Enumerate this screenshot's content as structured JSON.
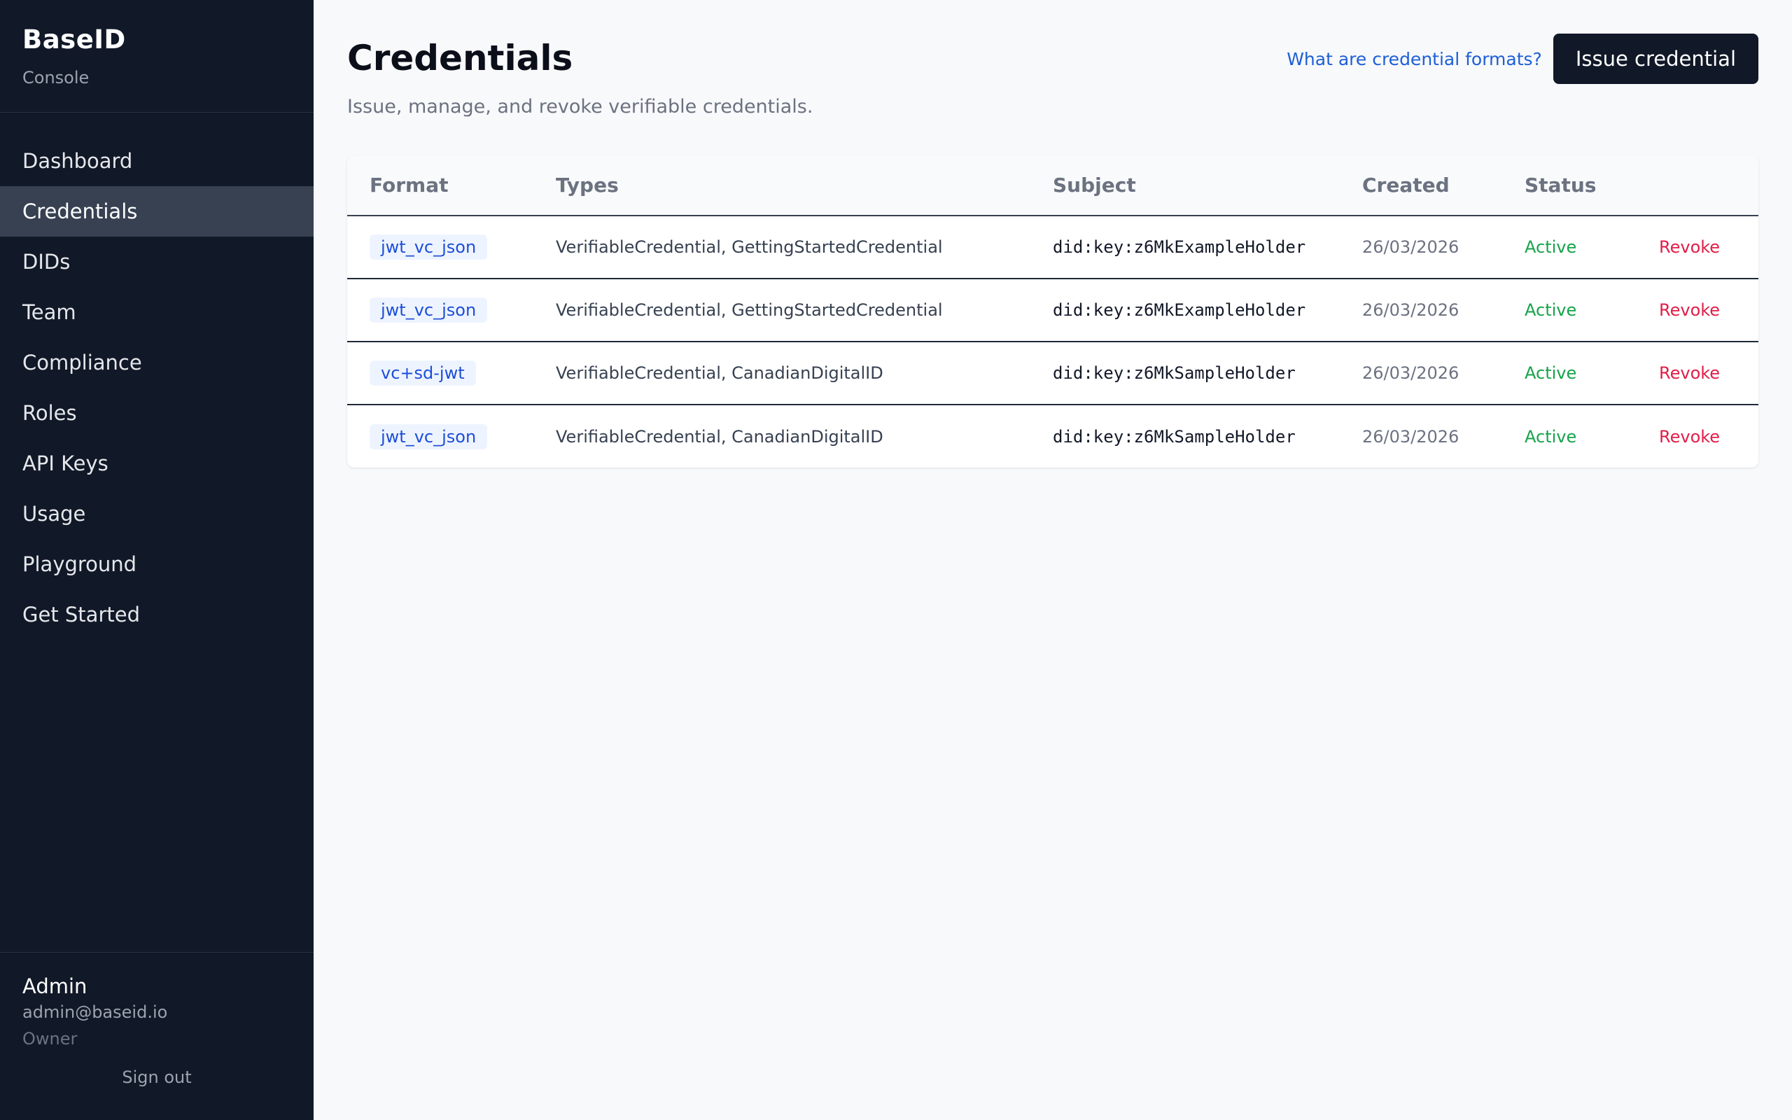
{
  "sidebar": {
    "brand": "BaseID",
    "subtitle": "Console",
    "nav": [
      {
        "label": "Dashboard"
      },
      {
        "label": "Credentials",
        "active": true
      },
      {
        "label": "DIDs"
      },
      {
        "label": "Team"
      },
      {
        "label": "Compliance"
      },
      {
        "label": "Roles"
      },
      {
        "label": "API Keys"
      },
      {
        "label": "Usage"
      },
      {
        "label": "Playground"
      },
      {
        "label": "Get Started"
      }
    ],
    "user": {
      "name": "Admin",
      "email": "admin@baseid.io",
      "role": "Owner",
      "signout_label": "Sign out"
    }
  },
  "main": {
    "title": "Credentials",
    "subtitle": "Issue, manage, and revoke verifiable credentials.",
    "help_link": "What are credential formats?",
    "issue_button": "Issue credential",
    "table": {
      "headers": [
        "Format",
        "Types",
        "Subject",
        "Created",
        "Status",
        ""
      ],
      "rows": [
        {
          "format": "jwt_vc_json",
          "types": "VerifiableCredential, GettingStartedCredential",
          "subject": "did:key:z6MkExampleHolder",
          "created": "26/03/2026",
          "status": "Active",
          "action": "Revoke"
        },
        {
          "format": "jwt_vc_json",
          "types": "VerifiableCredential, GettingStartedCredential",
          "subject": "did:key:z6MkExampleHolder",
          "created": "26/03/2026",
          "status": "Active",
          "action": "Revoke"
        },
        {
          "format": "vc+sd-jwt",
          "types": "VerifiableCredential, CanadianDigitalID",
          "subject": "did:key:z6MkSampleHolder",
          "created": "26/03/2026",
          "status": "Active",
          "action": "Revoke"
        },
        {
          "format": "jwt_vc_json",
          "types": "VerifiableCredential, CanadianDigitalID",
          "subject": "did:key:z6MkSampleHolder",
          "created": "26/03/2026",
          "status": "Active",
          "action": "Revoke"
        }
      ]
    }
  },
  "colors": {
    "sidebar_bg": "#111827",
    "active_nav_bg": "#374151",
    "accent_link": "#1d5fd6",
    "status_active": "#16a34a",
    "danger": "#e11d48"
  }
}
